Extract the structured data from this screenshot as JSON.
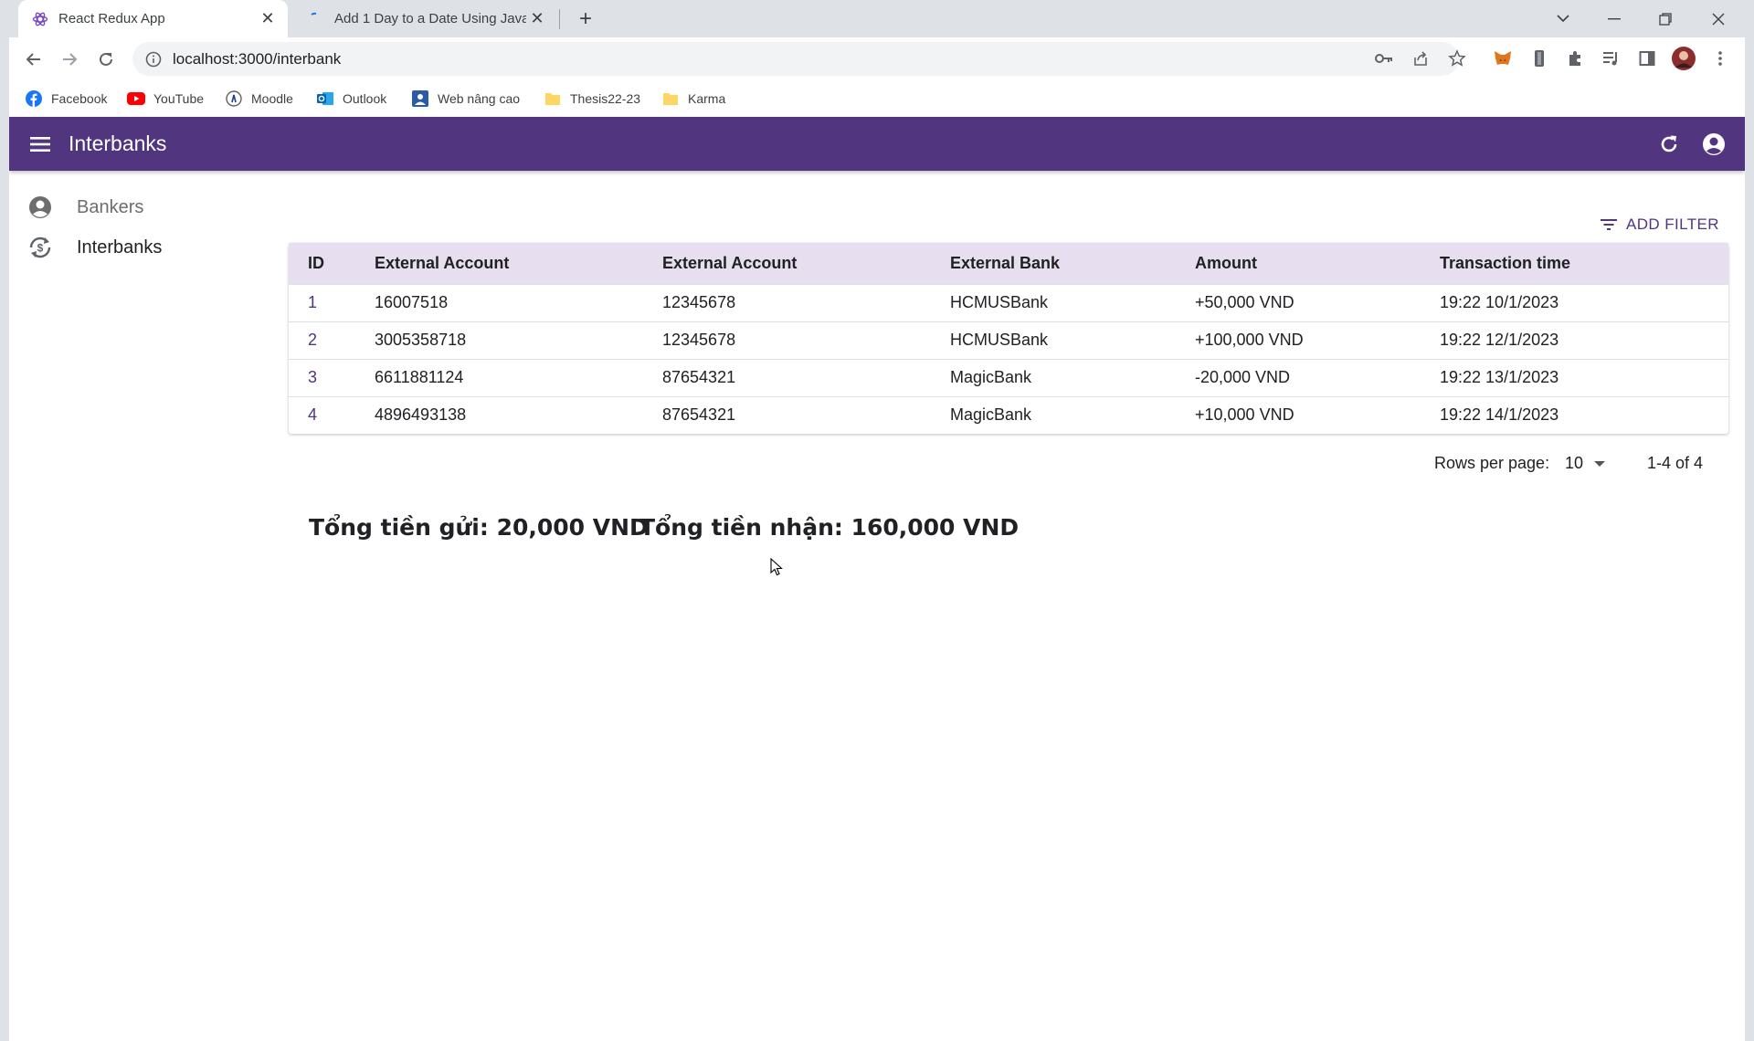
{
  "browser": {
    "tabs": [
      {
        "title": "React Redux App",
        "active": true
      },
      {
        "title": "Add 1 Day to a Date Using JavaS",
        "active": false
      }
    ],
    "url": "localhost:3000/interbank",
    "bookmarks": [
      {
        "label": "Facebook",
        "icon": "facebook-icon"
      },
      {
        "label": "YouTube",
        "icon": "youtube-icon"
      },
      {
        "label": "Moodle",
        "icon": "moodle-icon"
      },
      {
        "label": "Outlook",
        "icon": "outlook-icon"
      },
      {
        "label": "Web nâng cao",
        "icon": "web-icon"
      },
      {
        "label": "Thesis22-23",
        "icon": "folder-icon"
      },
      {
        "label": "Karma",
        "icon": "folder-icon"
      }
    ]
  },
  "app": {
    "title": "Interbanks",
    "accent": "#52357f",
    "header_bg": "#e7dff0"
  },
  "sidebar": {
    "items": [
      {
        "label": "Bankers",
        "icon": "account-circle-icon"
      },
      {
        "label": "Interbanks",
        "icon": "currency-exchange-icon"
      }
    ]
  },
  "toolbar": {
    "add_filter": "ADD FILTER"
  },
  "table": {
    "columns": [
      "ID",
      "External Account",
      "External Account",
      "External Bank",
      "Amount",
      "Transaction time"
    ],
    "rows": [
      [
        "1",
        "16007518",
        "12345678",
        "HCMUSBank",
        "+50,000 VND",
        "19:22 10/1/2023"
      ],
      [
        "2",
        "3005358718",
        "12345678",
        "HCMUSBank",
        "+100,000 VND",
        "19:22 12/1/2023"
      ],
      [
        "3",
        "6611881124",
        "87654321",
        "MagicBank",
        "-20,000 VND",
        "19:22 13/1/2023"
      ],
      [
        "4",
        "4896493138",
        "87654321",
        "MagicBank",
        "+10,000 VND",
        "19:22 14/1/2023"
      ]
    ]
  },
  "pagination": {
    "rows_per_page_label": "Rows per page:",
    "rows_per_page": "10",
    "range": "1-4 of 4"
  },
  "totals": {
    "sent": "Tổng tiền gửi: 20,000 VND",
    "received": "Tổng tiền nhận: 160,000 VND"
  }
}
